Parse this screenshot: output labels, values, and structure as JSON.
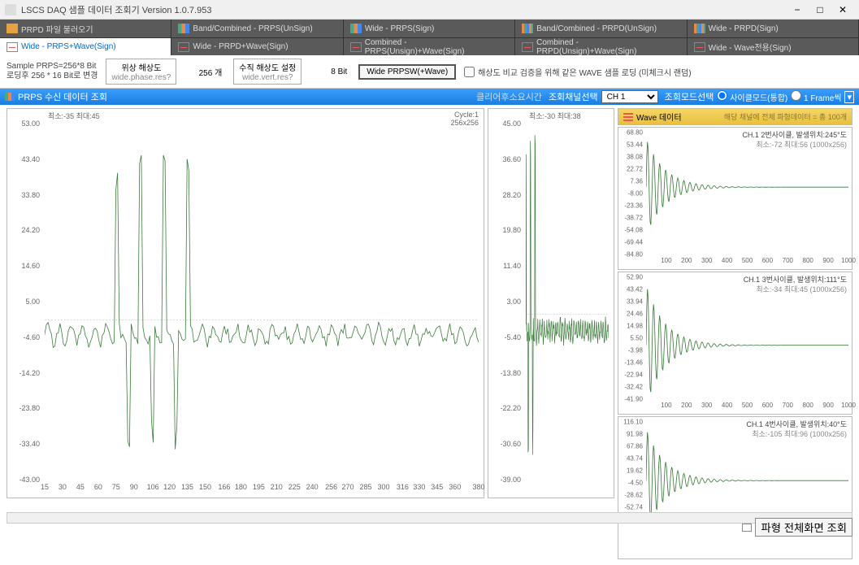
{
  "window": {
    "title": "LSCS DAQ 샘플 데이터 조회기 Version 1.0.7.953"
  },
  "tabs1": [
    {
      "label": "PRPD 파일 불러오기",
      "iconCls": "tab-icon-folder"
    },
    {
      "label": "Band/Combined - PRPS(UnSign)",
      "iconCls": "tab-icon-bars"
    },
    {
      "label": "Wide - PRPS(Sign)",
      "iconCls": "tab-icon-bars"
    },
    {
      "label": "Band/Combined - PRPD(UnSign)",
      "iconCls": "tab-icon-grid"
    },
    {
      "label": "Wide - PRPD(Sign)",
      "iconCls": "tab-icon-grid"
    }
  ],
  "tabs2": [
    {
      "label": "Wide - PRPS+Wave(Sign)",
      "iconCls": "tab-icon-wave",
      "active": true
    },
    {
      "label": "Wide - PRPD+Wave(Sign)",
      "iconCls": "tab-icon-wave"
    },
    {
      "label": "Combined - PRPS(Unsign)+Wave(Sign)",
      "iconCls": "tab-icon-wave"
    },
    {
      "label": "Combined - PRPD(Unsign)+Wave(Sign)",
      "iconCls": "tab-icon-wave"
    },
    {
      "label": "Wide - Wave전용(Sign)",
      "iconCls": "tab-icon-wave"
    }
  ],
  "params": {
    "sample_info_l1": "Sample PRPS=256*8 Bit",
    "sample_info_l2": "로딩후 256 * 16 Bit로 변경",
    "hres_label": "위상 해상도",
    "hres_sub": "wide.phase.res?",
    "hres_value": "256 개",
    "vres_label": "수직 해상도 설정",
    "vres_sub": "wide.vert.res?",
    "vres_value": "8 Bit",
    "mode_btn": "Wide PRPSW(+Wave)",
    "chk_label": "해상도 비교 검증을 위해 같은 WAVE 샘플 로딩 (미체크시 랜덤)"
  },
  "header": {
    "title": "PRPS 수신 데이터 조회",
    "status": "클리어후소요시간",
    "ch_label": "조회채널선택",
    "ch_value": "CH 1",
    "mode_label": "조회모드선택",
    "radio1": "사이클모드(통합)",
    "radio2": "1 Frame씩"
  },
  "chart_data": [
    {
      "type": "line",
      "stats": "최소:-35 최대:45",
      "cycle_l1": "Cycle:1",
      "cycle_l2": "256x256",
      "ylim": [
        -43.0,
        53.0
      ],
      "yticks": [
        53.0,
        43.4,
        33.8,
        24.2,
        14.6,
        5.0,
        -4.6,
        -14.2,
        -23.8,
        -33.4,
        -43.0
      ],
      "xlim": [
        15,
        380
      ],
      "xticks": [
        15,
        30,
        45,
        60,
        75,
        90,
        106,
        120,
        135,
        150,
        166,
        180,
        195,
        210,
        225,
        240,
        256,
        270,
        285,
        300,
        316,
        330,
        345,
        360,
        380
      ]
    },
    {
      "type": "line",
      "stats": "최소:-30 최대:38",
      "ylim": [
        -39.0,
        45.0
      ],
      "yticks": [
        45.0,
        36.6,
        28.2,
        19.8,
        11.4,
        3.0,
        -5.4,
        -13.8,
        -22.2,
        -30.6,
        -39.0
      ]
    }
  ],
  "wave": {
    "header_title": "Wave 데이터",
    "header_sub": "해당 채널에 전체 파형데이터 = 총 100개",
    "panels": [
      {
        "title": "CH.1 2번사이클, 발생위치:245°도",
        "sub": "최소:-72 최대:56 (1000x256)",
        "ylim": [
          -84.8,
          68.8
        ],
        "yticks": [
          68.8,
          53.44,
          38.08,
          22.72,
          7.36,
          -8.0,
          -23.36,
          -38.72,
          -54.08,
          -69.44,
          -84.8
        ],
        "xticks": [
          100,
          200,
          300,
          400,
          500,
          600,
          700,
          800,
          900,
          1000
        ]
      },
      {
        "title": "CH.1 3번사이클, 발생위치:111°도",
        "sub": "최소:-34 최대:45 (1000x256)",
        "ylim": [
          -41.9,
          52.9
        ],
        "yticks": [
          52.9,
          43.42,
          33.94,
          24.46,
          14.98,
          5.5,
          -3.98,
          -13.46,
          -22.94,
          -32.42,
          -41.9
        ],
        "xticks": [
          100,
          200,
          300,
          400,
          500,
          600,
          700,
          800,
          900,
          1000
        ]
      },
      {
        "title": "CH.1 4번사이클, 발생위치:40°도",
        "sub": "최소:-105 최대:96 (1000x256)",
        "ylim": [
          -125.1,
          116.1
        ],
        "yticks": [
          116.1,
          91.98,
          67.86,
          43.74,
          19.62,
          -4.5,
          -28.62,
          -52.74
        ],
        "xticks": []
      }
    ]
  },
  "footer": {
    "btn": "파형 전체화면 조회"
  }
}
